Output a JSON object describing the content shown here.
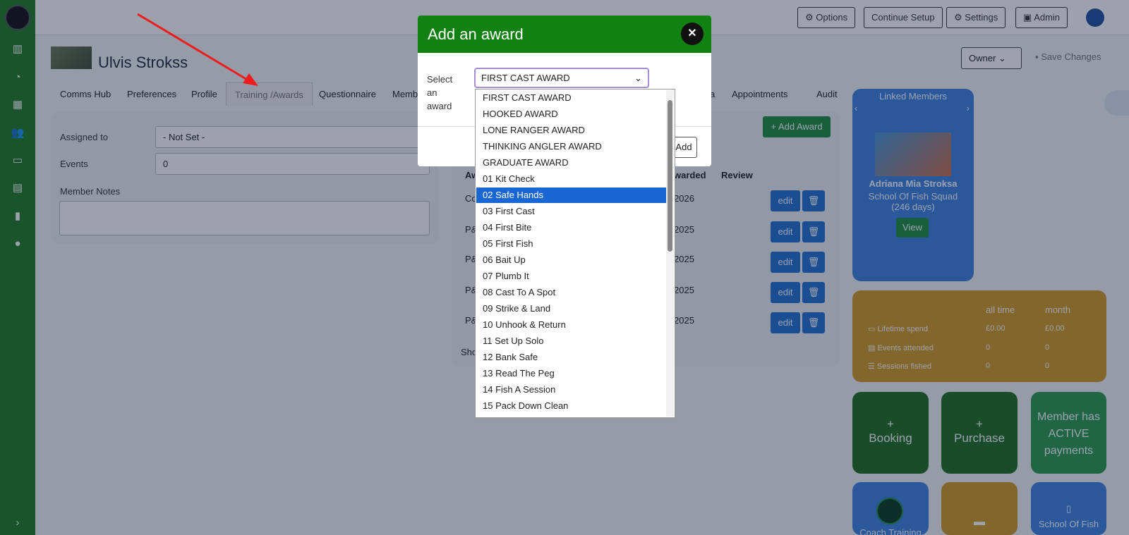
{
  "topbar": {
    "options": "Options",
    "continue_setup": "Continue Setup",
    "settings": "Settings",
    "admin": "Admin"
  },
  "member": {
    "name": "Ulvis Strokss",
    "role_select": "Owner",
    "save_changes": "Save Changes"
  },
  "tabs": [
    "Comms Hub",
    "Preferences",
    "Profile",
    "Training /Awards",
    "Questionnaire",
    "Memb",
    "a",
    "Appointments",
    "Audit"
  ],
  "details": {
    "assigned_label": "Assigned to",
    "assigned_value": "- Not Set -",
    "events_label": "Events",
    "events_value": "0",
    "notes_label": "Member Notes"
  },
  "awards_table": {
    "add_award": "+ Add Award",
    "col_award": "Aw",
    "col_awarded": "warded",
    "col_review": "Review",
    "edit": "edit",
    "rows": [
      {
        "award": "Co",
        "date": "2026"
      },
      {
        "award": "P&",
        "date": "2025"
      },
      {
        "award": "P&",
        "date": "2025"
      },
      {
        "award": "P&",
        "date": "2025"
      },
      {
        "award": "P&",
        "date": "2025"
      }
    ],
    "footer": "Sho"
  },
  "linked": {
    "title": "Linked Members",
    "member_name": "Adriana Mia Stroksa",
    "squad": "School Of Fish Squad (246 days)",
    "view": "View"
  },
  "stats": {
    "col_all": "all time",
    "col_month": "month",
    "rows": [
      {
        "label": "Lifetime spend",
        "all": "£0.00",
        "month": "£0.00"
      },
      {
        "label": "Events attended",
        "all": "0",
        "month": "0"
      },
      {
        "label": "Sessions fished",
        "all": "0",
        "month": "0"
      }
    ]
  },
  "actions": {
    "booking": "Booking",
    "purchase": "Purchase",
    "active": "Member has ACTIVE payments",
    "coach": "Coach Training",
    "school": "School Of Fish"
  },
  "modal": {
    "title": "Add an award",
    "select_label_1": "Select",
    "select_label_2": "an",
    "select_label_3": "award",
    "selected": "FIRST CAST AWARD",
    "add": "Add"
  },
  "options": [
    "FIRST CAST AWARD",
    "HOOKED AWARD",
    "LONE RANGER AWARD",
    "THINKING ANGLER AWARD",
    "GRADUATE AWARD",
    "01 Kit Check",
    "02 Safe Hands",
    "03 First Cast",
    "04 First Bite",
    "05 First Fish",
    "06 Bait Up",
    "07 Plumb It",
    "08 Cast To A Spot",
    "09 Strike & Land",
    "10 Unhook & Return",
    "11 Set Up Solo",
    "12 Bank Safe",
    "13 Read The Peg",
    "14 Fish A Session",
    "15 Pack Down Clean"
  ],
  "highlighted_option_index": 6,
  "colors": {
    "sidebar": "#1e7a1e",
    "modal_header": "#118211",
    "highlight": "#1a67d4",
    "blue_card": "#3b82e0",
    "gold_card": "#d49a22",
    "green_card": "#1e6e1e"
  }
}
